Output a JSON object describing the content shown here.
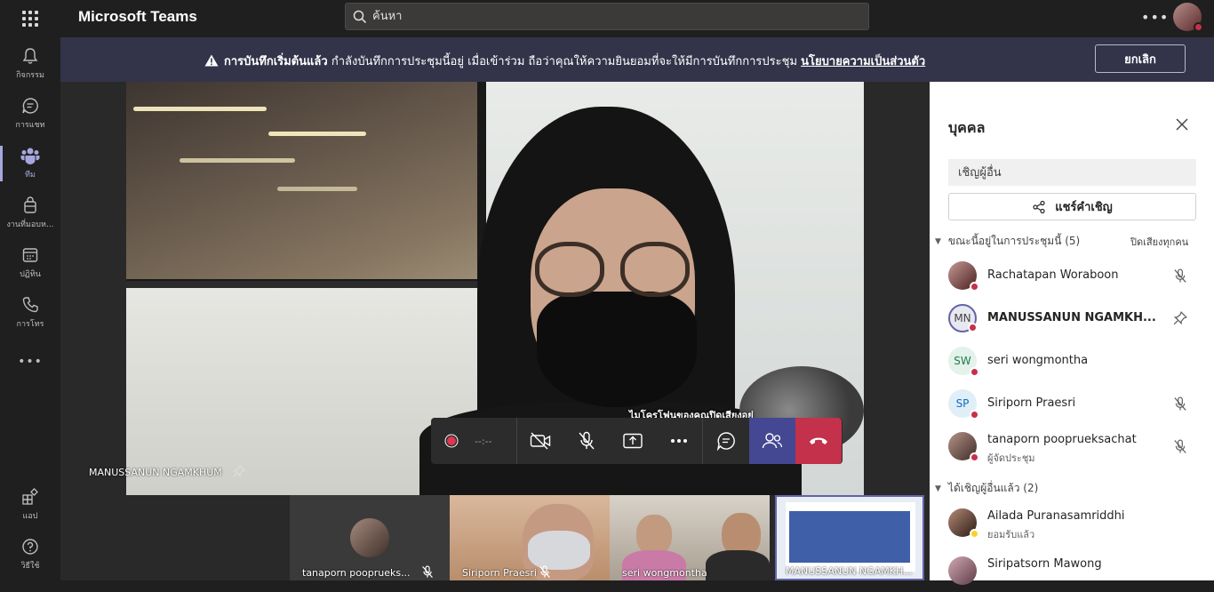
{
  "app": {
    "title": "Microsoft Teams"
  },
  "search": {
    "placeholder": "ค้นหา"
  },
  "rail": [
    {
      "id": "activity",
      "label": "กิจกรรม",
      "icon": "bell-icon"
    },
    {
      "id": "chat",
      "label": "การแชท",
      "icon": "chat-icon"
    },
    {
      "id": "teams",
      "label": "ทีม",
      "icon": "teams-icon",
      "active": true
    },
    {
      "id": "assignments",
      "label": "งานที่มอบห...",
      "icon": "assignments-icon"
    },
    {
      "id": "calendar",
      "label": "ปฏิทิน",
      "icon": "calendar-icon"
    },
    {
      "id": "calls",
      "label": "การโทร",
      "icon": "phone-icon"
    },
    {
      "id": "apps",
      "label": "แอป",
      "icon": "apps-icon"
    },
    {
      "id": "help",
      "label": "วิธีใช้",
      "icon": "help-icon"
    }
  ],
  "banner": {
    "bold": "การบันทึกเริ่มต้นแล้ว",
    "text": "กำลังบันทึกการประชุมนี้อยู่ เมื่อเข้าร่วม ถือว่าคุณให้ความยินยอมที่จะให้มีการบันทึกการประชุม",
    "link": "นโยบายความเป็นส่วนตัว",
    "dismiss": "ยกเลิก",
    "icon": "warning-icon"
  },
  "main_video": {
    "name": "MANUSSANUN NGAMKHUM",
    "caption": "ไมโครโฟนของคุณปิดเสียงอยู่"
  },
  "controls": {
    "timer": "--:--"
  },
  "thumbnails": [
    {
      "name": "tanaporn pooprueks...",
      "muted": true
    },
    {
      "name": "Siriporn Praesri",
      "muted": true
    },
    {
      "name": "seri wongmontha",
      "muted": false
    },
    {
      "name": "MANUSSANUN NGAMKH...",
      "muted": false
    }
  ],
  "panel": {
    "title": "บุคคล",
    "invite_placeholder": "เชิญผู้อื่น",
    "share_label": "แชร์คำเชิญ",
    "in_meeting_heading": "ขณะนี้อยู่ในการประชุมนี้ (5)",
    "mute_all": "ปิดเสียงทุกคน",
    "invited_heading": "ได้เชิญผู้อื่นแล้ว (2)",
    "participants": [
      {
        "name": "Rachatapan Woraboon",
        "initials": "",
        "photo": true,
        "status": "busy",
        "trailing": "mic-off-icon"
      },
      {
        "name": "MANUSSANUN NGAMKH...",
        "initials": "MN",
        "photo": false,
        "status": "dnd",
        "trailing": "pin-icon",
        "bold": true,
        "color": "#e8e8f0",
        "fg": "#424242"
      },
      {
        "name": "seri wongmontha",
        "initials": "SW",
        "photo": false,
        "status": "busy",
        "trailing": "",
        "color": "#e3f2ea",
        "fg": "#237b4b"
      },
      {
        "name": "Siriporn Praesri",
        "initials": "SP",
        "photo": false,
        "status": "busy",
        "trailing": "mic-off-icon",
        "color": "#e0eef8",
        "fg": "#0f6cbd"
      },
      {
        "name": "tanaporn pooprueksachat",
        "role": "ผู้จัดประชุม",
        "initials": "",
        "photo": true,
        "status": "busy",
        "trailing": "mic-off-icon"
      }
    ],
    "invited": [
      {
        "name": "Ailada Puranasamriddhi",
        "role": "ยอมรับแล้ว",
        "photo": true,
        "status": "accepted"
      },
      {
        "name": "Siripatsorn Mawong",
        "photo": true,
        "status": "none"
      }
    ]
  }
}
